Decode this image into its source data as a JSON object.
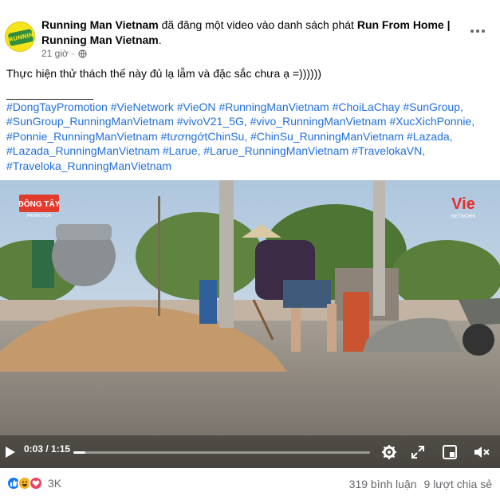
{
  "post": {
    "page_name": "Running Man Vietnam",
    "action_text": " đã đăng một video vào danh sách phát ",
    "playlist": "Run From Home | Running Man Vietnam",
    "playlist_suffix": ".",
    "time_ago": "21 giờ",
    "separator": "·",
    "privacy_icon": "globe-icon",
    "more_icon": "more-horizontal-icon"
  },
  "avatar": {
    "logo_text": "RUNNING MAN",
    "colors": {
      "bg": "#f6e41a",
      "accent": "#2f8f3e"
    }
  },
  "caption": "Thực hiện thử thách thế này đủ lạ lẫm và đặc sắc chưa ạ =))))))",
  "divider": "______________",
  "hashtags": [
    {
      "text": "#DongTayPromotion",
      "sep": " "
    },
    {
      "text": "#VieNetwork",
      "sep": " "
    },
    {
      "text": "#VieON",
      "sep": " "
    },
    {
      "text": "#RunningManVietnam",
      "sep": " "
    },
    {
      "text": "#ChoiLaChay",
      "sep": " "
    },
    {
      "text": "#SunGroup",
      "sep": ", "
    },
    {
      "text": "#SunGroup_RunningManVietnam",
      "sep": " "
    },
    {
      "text": "#vivoV21_5G",
      "sep": ", "
    },
    {
      "text": "#vivo_RunningManVietnam",
      "sep": " "
    },
    {
      "text": "#XucXichPonnie",
      "sep": ", "
    },
    {
      "text": "#Ponnie_RunningManVietnam",
      "sep": " "
    },
    {
      "text": "#tươngớtChinSu",
      "sep": ", "
    },
    {
      "text": "#ChinSu_RunningManVietnam",
      "sep": " "
    },
    {
      "text": "#Lazada",
      "sep": ", "
    },
    {
      "text": "#Lazada_RunningManVietnam",
      "sep": " "
    },
    {
      "text": "#Larue",
      "sep": ", "
    },
    {
      "text": "#Larue_RunningManVietnam",
      "sep": " "
    },
    {
      "text": "#TravelokaVN",
      "sep": ", "
    },
    {
      "text": "#Traveloka_RunningManVietnam",
      "sep": ""
    }
  ],
  "video": {
    "current_time": "0:03",
    "duration": "1:15",
    "time_separator": " / ",
    "progress": 0.04,
    "watermark_left": {
      "line1": "ĐỒNG TÂY",
      "line2": "PROMOTION"
    },
    "watermark_right": {
      "line1": "Vie",
      "line2": "NETWORK"
    },
    "controls": {
      "play_icon": "play-icon",
      "settings_icon": "gear-icon",
      "fullscreen_icon": "fullscreen-icon",
      "pip_icon": "picture-in-picture-icon",
      "mute_icon": "muted-speaker-icon"
    }
  },
  "footer": {
    "reactions": [
      "like-icon",
      "haha-icon",
      "love-icon"
    ],
    "reaction_count": "3K",
    "comments": "319 bình luận",
    "shares": "9 lượt chia sẻ"
  },
  "colors": {
    "link": "#216fdb",
    "muted": "#65676b",
    "like": "#1877f2",
    "love": "#f33e58",
    "haha": "#f7b125"
  }
}
